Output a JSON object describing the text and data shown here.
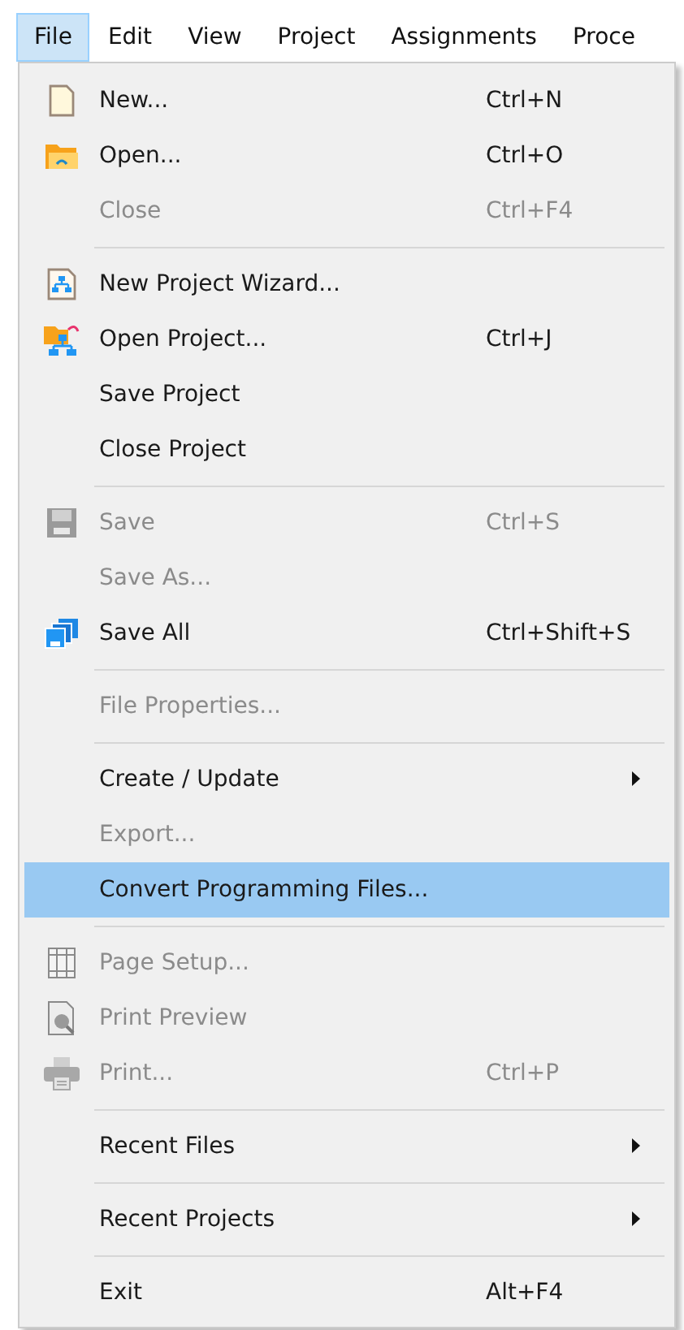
{
  "menubar": [
    {
      "label": "File",
      "selected": true
    },
    {
      "label": "Edit",
      "selected": false
    },
    {
      "label": "View",
      "selected": false
    },
    {
      "label": "Project",
      "selected": false
    },
    {
      "label": "Assignments",
      "selected": false
    },
    {
      "label": "Proce",
      "selected": false
    }
  ],
  "menu": {
    "items": [
      {
        "kind": "item",
        "label": "New...",
        "shortcut": "Ctrl+N",
        "disabled": false,
        "selected": false,
        "submenu": false
      },
      {
        "kind": "item",
        "label": "Open...",
        "shortcut": "Ctrl+O",
        "disabled": false,
        "selected": false,
        "submenu": false
      },
      {
        "kind": "item",
        "label": "Close",
        "shortcut": "Ctrl+F4",
        "disabled": true,
        "selected": false,
        "submenu": false
      },
      {
        "kind": "separator"
      },
      {
        "kind": "item",
        "label": "New Project Wizard...",
        "disabled": false,
        "selected": false,
        "submenu": false
      },
      {
        "kind": "item",
        "label": "Open Project...",
        "shortcut": "Ctrl+J",
        "disabled": false,
        "selected": false,
        "submenu": false
      },
      {
        "kind": "item",
        "label": "Save Project",
        "disabled": false,
        "selected": false,
        "submenu": false
      },
      {
        "kind": "item",
        "label": "Close Project",
        "disabled": false,
        "selected": false,
        "submenu": false
      },
      {
        "kind": "separator"
      },
      {
        "kind": "item",
        "label": "Save",
        "shortcut": "Ctrl+S",
        "disabled": true,
        "selected": false,
        "submenu": false
      },
      {
        "kind": "item",
        "label": "Save As...",
        "disabled": true,
        "selected": false,
        "submenu": false
      },
      {
        "kind": "item",
        "label": "Save All",
        "shortcut": "Ctrl+Shift+S",
        "disabled": false,
        "selected": false,
        "submenu": false
      },
      {
        "kind": "separator"
      },
      {
        "kind": "item",
        "label": "File Properties...",
        "disabled": true,
        "selected": false,
        "submenu": false
      },
      {
        "kind": "separator"
      },
      {
        "kind": "item",
        "label": "Create / Update",
        "disabled": false,
        "selected": false,
        "submenu": true
      },
      {
        "kind": "item",
        "label": "Export...",
        "disabled": true,
        "selected": false,
        "submenu": false
      },
      {
        "kind": "item",
        "label": "Convert Programming Files...",
        "disabled": false,
        "selected": true,
        "submenu": false
      },
      {
        "kind": "separator"
      },
      {
        "kind": "item",
        "label": "Page Setup...",
        "disabled": true,
        "selected": false,
        "submenu": false
      },
      {
        "kind": "item",
        "label": "Print Preview",
        "disabled": true,
        "selected": false,
        "submenu": false
      },
      {
        "kind": "item",
        "label": "Print...",
        "shortcut": "Ctrl+P",
        "disabled": true,
        "selected": false,
        "submenu": false
      },
      {
        "kind": "separator"
      },
      {
        "kind": "item",
        "label": "Recent Files",
        "disabled": false,
        "selected": false,
        "submenu": true
      },
      {
        "kind": "separator"
      },
      {
        "kind": "item",
        "label": "Recent Projects",
        "disabled": false,
        "selected": false,
        "submenu": true
      },
      {
        "kind": "separator"
      },
      {
        "kind": "item",
        "label": "Exit",
        "shortcut": "Alt+F4",
        "disabled": false,
        "selected": false,
        "submenu": false
      }
    ]
  }
}
